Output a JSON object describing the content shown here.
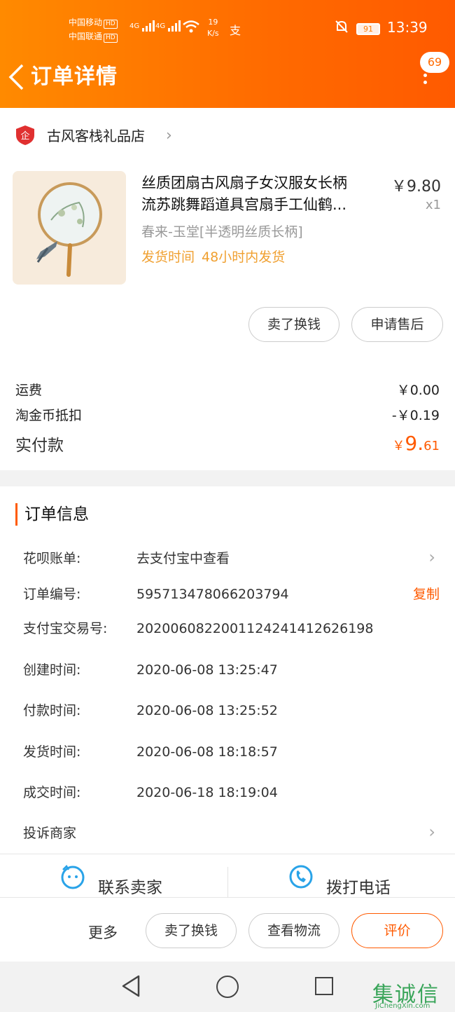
{
  "status_bar": {
    "carrier1": "中国移动",
    "carrier2": "中国联通",
    "hd": "HD",
    "net1": "4G",
    "net2": "4G",
    "speed_value": "19",
    "speed_unit": "K/s",
    "alipay_glyph": "支",
    "battery": "91",
    "time": "13:39"
  },
  "header": {
    "title": "订单详情",
    "message_count": "69"
  },
  "shop": {
    "badge": "企",
    "name": "古风客栈礼品店"
  },
  "product": {
    "title_line1": "丝质团扇古风扇子女汉服女长柄",
    "title_line2": "流苏跳舞蹈道具宫扇手工仙鹤...",
    "price": "￥9.80",
    "quantity": "x1",
    "sku": "春来-玉堂[半透明丝质长柄]",
    "ship_label": "发货时间",
    "ship_value": "48小时内发货"
  },
  "item_actions": {
    "sell": "卖了换钱",
    "after_sale": "申请售后"
  },
  "fees": {
    "shipping_label": "运费",
    "shipping_value": "￥0.00",
    "coins_label": "淘金币抵扣",
    "coins_value": "-￥0.19",
    "paid_label": "实付款",
    "paid_currency": "￥",
    "paid_int": "9.",
    "paid_dec": "61"
  },
  "order_info": {
    "section_title": "订单信息",
    "rows": [
      {
        "label": "花呗账单:",
        "value": "去支付宝中查看"
      },
      {
        "label": "订单编号:",
        "value": "595713478066203794",
        "action": "复制"
      },
      {
        "label": "支付宝交易号:",
        "value": "2020060822001124241412626198"
      },
      {
        "label": "创建时间:",
        "value": "2020-06-08 13:25:47"
      },
      {
        "label": "付款时间:",
        "value": "2020-06-08 13:25:52"
      },
      {
        "label": "发货时间:",
        "value": "2020-06-08 18:18:57"
      },
      {
        "label": "成交时间:",
        "value": "2020-06-18 18:19:04"
      },
      {
        "label": "投诉商家",
        "value": ""
      }
    ]
  },
  "contact": {
    "seller": "联系卖家",
    "phone": "拨打电话"
  },
  "bottom_actions": {
    "more": "更多",
    "sell": "卖了换钱",
    "logistics": "查看物流",
    "review": "评价"
  },
  "watermark": {
    "chars": "集诚信",
    "url": "JiChengXin.com"
  },
  "colors": {
    "brand_orange": "#ff6a00",
    "price_orange": "#ff5a00",
    "ship_orange": "#f0a030"
  }
}
